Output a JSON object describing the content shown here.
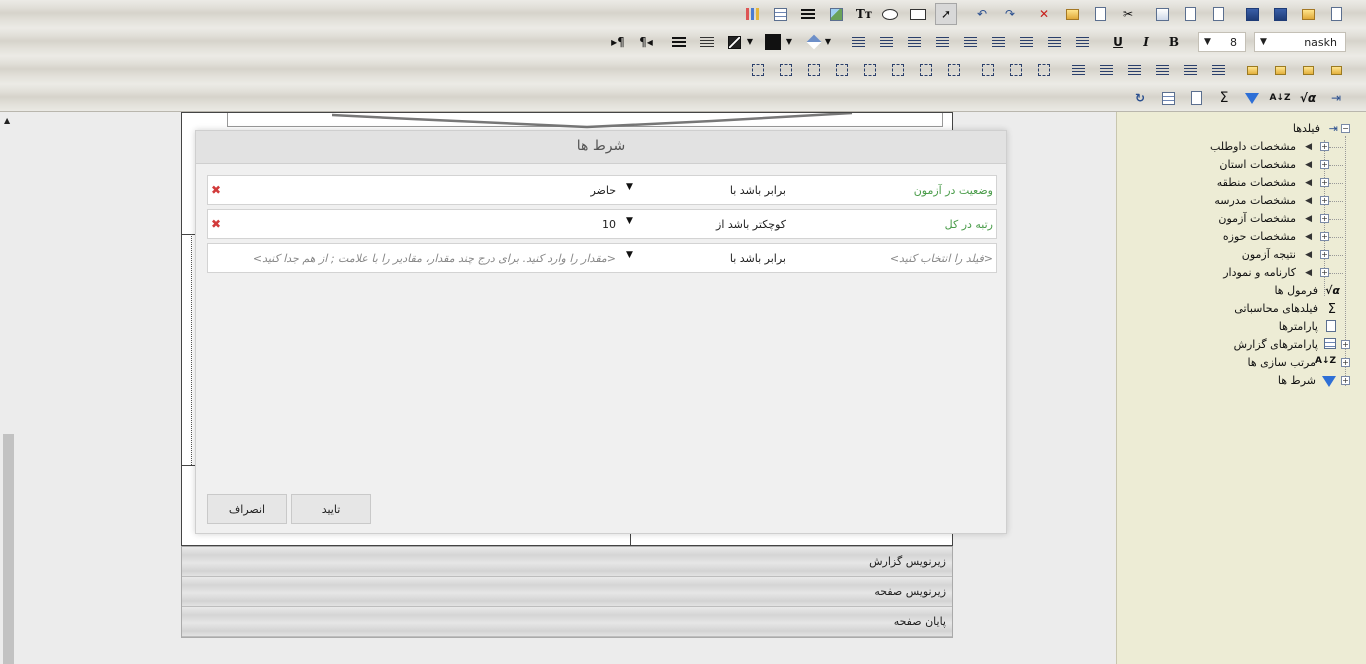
{
  "toolbar": {
    "font_name": "naskh",
    "font_size": "8"
  },
  "bands": {
    "report_footer": "زیرنویس گزارش",
    "page_footer": "زیرنویس صفحه",
    "page_end": "پایان صفحه"
  },
  "tree": {
    "root": "فیلدها",
    "fields": [
      "مشخصات داوطلب",
      "مشخصات استان",
      "مشخصات منطقه",
      "مشخصات مدرسه",
      "مشخصات آزمون",
      "مشخصات حوزه",
      "نتیجه آزمون",
      "کارنامه و نمودار"
    ],
    "formulas": "فرمول ها",
    "computed_fields": "فیلدهای محاسباتی",
    "parameters": "پارامترها",
    "report_parameters": "پارامترهای گزارش",
    "sorts": "مرتب سازی ها",
    "conditions": "شرط ها"
  },
  "dialog": {
    "title": "شرط ها",
    "conditions": [
      {
        "field": "وضعیت در آزمون",
        "operator": "برابر باشد با",
        "value": "حاضر"
      },
      {
        "field": "رتبه در کل",
        "operator": "کوچکتر باشد از",
        "value": "10"
      }
    ],
    "new_condition": {
      "field_placeholder": "<فیلد را انتخاب کنید>",
      "operator": "برابر باشد با",
      "value_placeholder": "<مقدار را وارد کنید. برای درج چند مقدار، مقادیر را با علامت ; از هم جدا کنید>"
    },
    "confirm_label": "تایید",
    "cancel_label": "انصراف"
  }
}
